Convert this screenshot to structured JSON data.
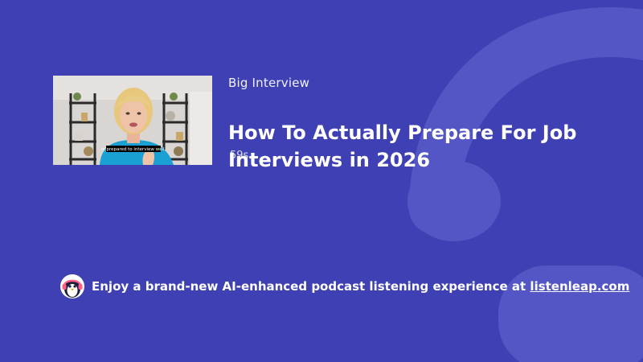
{
  "episode": {
    "channel": "Big Interview",
    "title": "How To Actually Prepare For Job Interviews in 2026",
    "duration": "59s",
    "thumbnail_caption": "in prepared to interview well,"
  },
  "promo": {
    "text": "Enjoy a brand-new AI-enhanced podcast listening experience at",
    "link_text": "listenleap.com"
  },
  "colors": {
    "background": "#3e40b4",
    "text": "#ffffff"
  },
  "icons": {
    "background_logo": "headphones-logo-watermark",
    "promo_avatar": "penguin-headphones-icon"
  }
}
